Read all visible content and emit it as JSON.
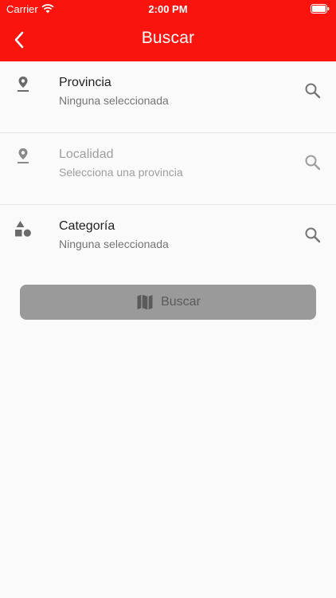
{
  "status_bar": {
    "carrier": "Carrier",
    "time": "2:00 PM"
  },
  "header": {
    "title": "Buscar",
    "background_color": "#f9150d"
  },
  "rows": [
    {
      "title": "Provincia",
      "subtitle": "Ninguna seleccionada",
      "icon": "location-pin-icon",
      "enabled": true
    },
    {
      "title": "Localidad",
      "subtitle": "Selecciona una provincia",
      "icon": "location-pin-icon",
      "enabled": false
    },
    {
      "title": "Categoría",
      "subtitle": "Ninguna seleccionada",
      "icon": "category-shapes-icon",
      "enabled": true
    }
  ],
  "search_button": {
    "label": "Buscar",
    "icon": "map-icon",
    "enabled": false
  }
}
